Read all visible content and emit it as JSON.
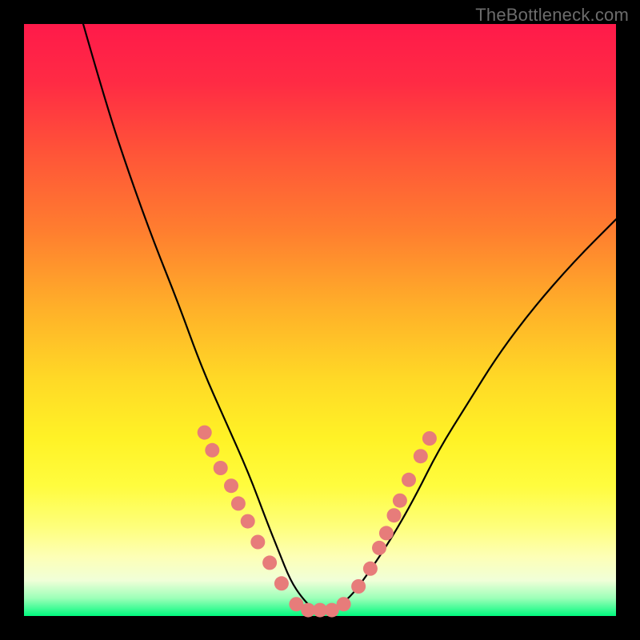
{
  "watermark": "TheBottleneck.com",
  "colors": {
    "page_bg": "#000000",
    "dot": "#e77c7a",
    "curve": "#000000",
    "watermark": "#6c6c6c",
    "gradient_top": "#ff1a4a",
    "gradient_bottom": "#00f97e"
  },
  "chart_data": {
    "type": "line",
    "title": "",
    "xlabel": "",
    "ylabel": "",
    "xlim": [
      0,
      100
    ],
    "ylim": [
      0,
      100
    ],
    "grid": false,
    "legend": false,
    "note": "Axis values are approximate percentage positions; chart has no visible tick labels.",
    "series": [
      {
        "name": "bottleneck-curve",
        "x": [
          10,
          14,
          18,
          22,
          26,
          30,
          34,
          38,
          41,
          43,
          45,
          47,
          49,
          52,
          55,
          58,
          62,
          66,
          70,
          75,
          80,
          86,
          93,
          100
        ],
        "y": [
          100,
          86,
          74,
          63,
          53,
          42,
          33,
          24,
          16,
          11,
          6,
          3,
          1,
          1,
          3,
          7,
          13,
          20,
          28,
          36,
          44,
          52,
          60,
          67
        ]
      }
    ],
    "markers": [
      {
        "name": "left-cluster",
        "x": 30.5,
        "y": 31
      },
      {
        "name": "left-cluster",
        "x": 31.8,
        "y": 28
      },
      {
        "name": "left-cluster",
        "x": 33.2,
        "y": 25
      },
      {
        "name": "left-cluster",
        "x": 35.0,
        "y": 22
      },
      {
        "name": "left-cluster",
        "x": 36.2,
        "y": 19
      },
      {
        "name": "left-cluster",
        "x": 37.8,
        "y": 16
      },
      {
        "name": "left-cluster",
        "x": 39.5,
        "y": 12.5
      },
      {
        "name": "left-cluster",
        "x": 41.5,
        "y": 9
      },
      {
        "name": "left-cluster",
        "x": 43.5,
        "y": 5.5
      },
      {
        "name": "valley-floor",
        "x": 46.0,
        "y": 2
      },
      {
        "name": "valley-floor",
        "x": 48.0,
        "y": 1
      },
      {
        "name": "valley-floor",
        "x": 50.0,
        "y": 1
      },
      {
        "name": "valley-floor",
        "x": 52.0,
        "y": 1
      },
      {
        "name": "valley-floor",
        "x": 54.0,
        "y": 2
      },
      {
        "name": "right-cluster",
        "x": 56.5,
        "y": 5
      },
      {
        "name": "right-cluster",
        "x": 58.5,
        "y": 8
      },
      {
        "name": "right-cluster",
        "x": 60.0,
        "y": 11.5
      },
      {
        "name": "right-cluster",
        "x": 61.2,
        "y": 14
      },
      {
        "name": "right-cluster",
        "x": 62.5,
        "y": 17
      },
      {
        "name": "right-cluster",
        "x": 63.5,
        "y": 19.5
      },
      {
        "name": "right-cluster",
        "x": 65.0,
        "y": 23
      },
      {
        "name": "right-cluster",
        "x": 67.0,
        "y": 27
      },
      {
        "name": "right-cluster",
        "x": 68.5,
        "y": 30
      }
    ]
  }
}
